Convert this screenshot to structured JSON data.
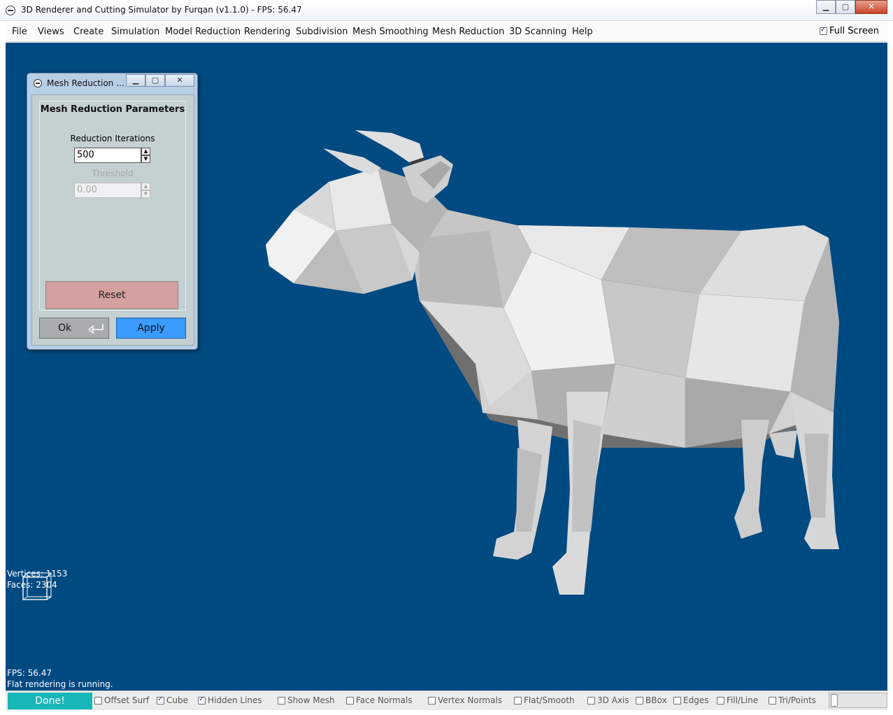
{
  "window": {
    "title": "3D Renderer and Cutting Simulator by Furqan (v1.1.0) - FPS: 56.47",
    "minimize": "▁",
    "maximize": "▢",
    "close": "✕"
  },
  "menu": {
    "items": [
      "File",
      "Views",
      "Create",
      "Simulation",
      "Model Reduction",
      "Rendering",
      "Subdivision",
      "Mesh Smoothing",
      "Mesh Reduction",
      "3D Scanning",
      "Help"
    ],
    "fullscreen_label": "Full Screen",
    "fullscreen_checked": true
  },
  "viewport": {
    "background": "#004a82",
    "model_color": "#d6d6d6",
    "vertices_text": "Vertices: 1153",
    "faces_text": "Faces: 2304",
    "fps_text": "FPS: 56.47",
    "status_text": "Flat rendering is running."
  },
  "dialog": {
    "title": "Mesh Reduction ...",
    "heading": "Mesh Reduction Parameters",
    "iterations_label": "Reduction Iterations",
    "iterations_value": "500",
    "threshold_label": "Threshold",
    "threshold_value": "0.00",
    "reset_label": "Reset",
    "ok_label": "Ok",
    "apply_label": "Apply"
  },
  "bottom": {
    "done_label": "Done!",
    "options": [
      {
        "label": "Offset Surf",
        "checked": false
      },
      {
        "label": "Cube",
        "checked": true
      },
      {
        "label": "Hidden Lines",
        "checked": true
      },
      {
        "label": "Show Mesh",
        "checked": false
      },
      {
        "label": "Face Normals",
        "checked": false
      },
      {
        "label": "Vertex Normals",
        "checked": false
      },
      {
        "label": "Flat/Smooth",
        "checked": false
      },
      {
        "label": "3D Axis",
        "checked": false
      },
      {
        "label": "BBox",
        "checked": false
      },
      {
        "label": "Edges",
        "checked": false
      },
      {
        "label": "Fill/Line",
        "checked": false
      },
      {
        "label": "Tri/Points",
        "checked": false
      }
    ]
  }
}
